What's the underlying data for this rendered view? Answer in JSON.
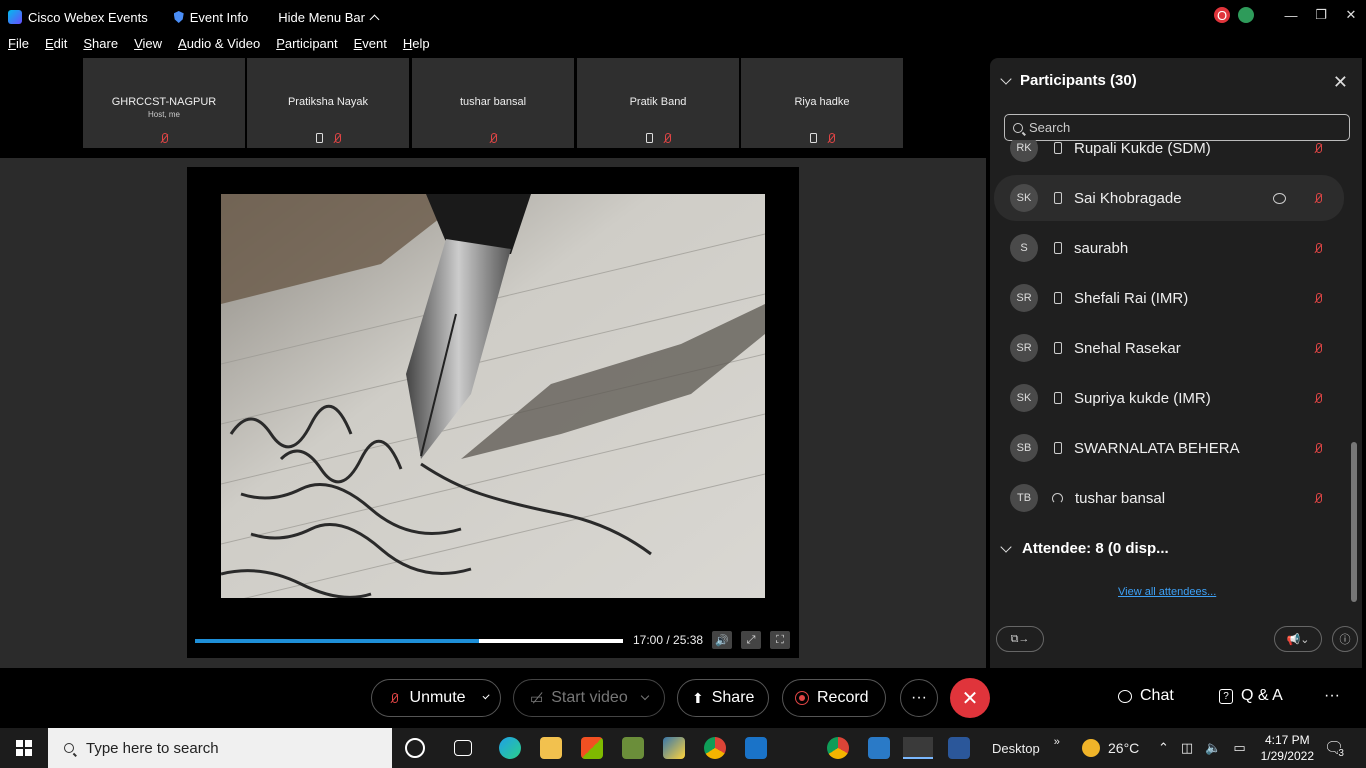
{
  "titlebar": {
    "app_name": "Cisco Webex Events",
    "event_info": "Event Info",
    "hide_menu": "Hide Menu Bar",
    "status_badge": "O"
  },
  "menu": [
    "File",
    "Edit",
    "Share",
    "View",
    "Audio & Video",
    "Participant",
    "Event",
    "Help"
  ],
  "thumbnails": [
    {
      "name": "GHRCCST-NAGPUR",
      "sub": "Host, me"
    },
    {
      "name": "Pratiksha Nayak",
      "sub": ""
    },
    {
      "name": "tushar bansal",
      "sub": ""
    },
    {
      "name": "Pratik Band",
      "sub": ""
    },
    {
      "name": "Riya hadke",
      "sub": ""
    }
  ],
  "video": {
    "time": "17:00 / 25:38",
    "progress": 0.663
  },
  "participants_panel": {
    "title": "Participants (30)",
    "search_placeholder": "Search",
    "rows": [
      {
        "initials": "RK",
        "name": "Rupali Kukde (SDM)",
        "device": "phone"
      },
      {
        "initials": "SK",
        "name": "Sai Khobragade",
        "device": "phone"
      },
      {
        "initials": "S",
        "name": "saurabh",
        "device": "phone"
      },
      {
        "initials": "SR",
        "name": "Shefali Rai (IMR)",
        "device": "phone"
      },
      {
        "initials": "SR",
        "name": "Snehal Rasekar",
        "device": "phone"
      },
      {
        "initials": "SK",
        "name": "Supriya kukde (IMR)",
        "device": "phone"
      },
      {
        "initials": "SB",
        "name": "SWARNALATA BEHERA",
        "device": "phone"
      },
      {
        "initials": "TB",
        "name": "tushar bansal",
        "device": "headset"
      }
    ],
    "attendee_header": "Attendee: 8 (0 disp...",
    "view_all": "View all attendees..."
  },
  "controls": {
    "unmute": "Unmute",
    "start_video": "Start video",
    "share": "Share",
    "record": "Record",
    "more": "···",
    "end": "✕",
    "chat": "Chat",
    "qa": "Q & A",
    "overflow": "···"
  },
  "taskbar": {
    "search_placeholder": "Type here to search",
    "desktop": "Desktop",
    "temperature": "26°C",
    "time": "4:17 PM",
    "date": "1/29/2022",
    "notifications": "3"
  },
  "colors": {
    "accent_blue": "#1e8fd8",
    "end_red": "#e0343b",
    "muted_red": "#e04545",
    "panel_bg": "#1f1f1f"
  }
}
